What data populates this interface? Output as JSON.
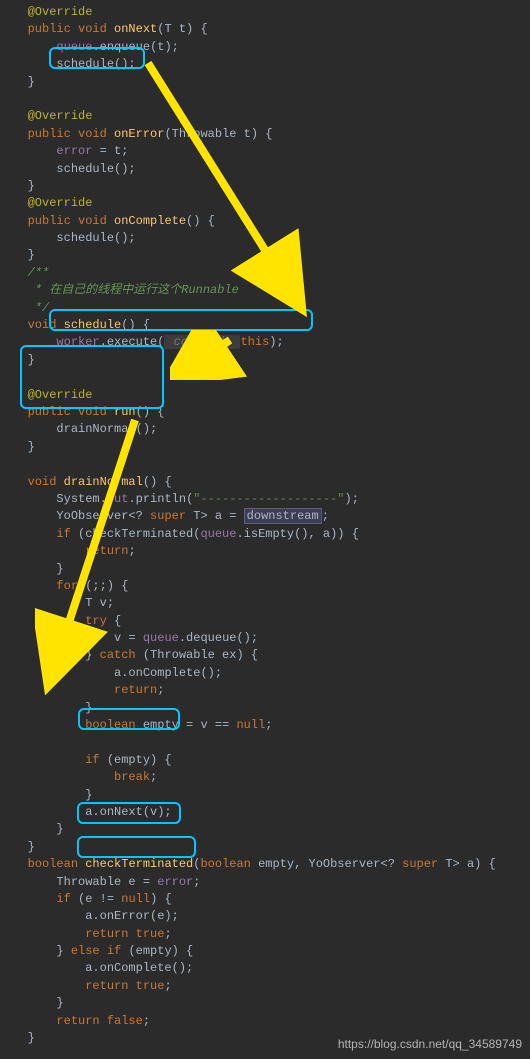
{
  "code": {
    "l01_ann": "@Override",
    "l02a": "public void",
    "l02_name": "onNext",
    "l02b": "(T t) {",
    "l03a": "queue",
    "l03b": ".",
    "l03c": "enqueue",
    "l03d": "(t);",
    "l04": "schedule();",
    "l05": "}",
    "l06_ann": "@Override",
    "l07a": "public void",
    "l07_name": "onError",
    "l07b": "(Throwable t) {",
    "l08a": "error",
    "l08b": " = t;",
    "l09": "schedule();",
    "l10": "}",
    "l11_ann": "@Override",
    "l12a": "public void",
    "l12_name": "onComplete",
    "l12b": "() {",
    "l13": "schedule();",
    "l14": "}",
    "c1": "/**",
    "c2": " * 在自己的线程中运行这个",
    "c2_tag": "Runnable",
    "c3": " */",
    "l15a": "void",
    "l15_name": "schedule",
    "l15b": "() {",
    "l16a": "worker",
    "l16b": ".execute(",
    "l16_hint": " command: ",
    "l16c": "this",
    "l16d": ");",
    "l17": "}",
    "l18_ann": "@Override",
    "l19a": "public void",
    "l19_name": "run",
    "l19b": "() {",
    "l20": "drainNormal();",
    "l21": "}",
    "dn_a": "void",
    "dn_name": "drainNormal",
    "dn_b": "() {",
    "dn1a": "System.",
    "dn1_out": "out",
    "dn1b": ".println(",
    "dn1_str": "\"-------------------\"",
    "dn1c": ");",
    "dn2a": "YoObserver<?",
    "dn2_kw": "super",
    "dn2b": " T> a = ",
    "dn2_ref": "downstream",
    "dn2c": ";",
    "dn3a": "if",
    "dn3b": " (checkTerminated(",
    "dn3_q": "queue",
    "dn3c": ".isEmpty(), a)) {",
    "dn4a": "return",
    "dn4b": ";",
    "dn5": "}",
    "dn6a": "for",
    "dn6b": " (;;) {",
    "dn7": "T v;",
    "dn8a": "try",
    "dn8b": " {",
    "dn9a": "v = ",
    "dn9_q": "queue",
    "dn9b": ".dequeue();",
    "dn10a": "} ",
    "dn10_kw": "catch",
    "dn10b": " (Throwable ex) {",
    "dn11": "a.onComplete();",
    "dn12a": "return",
    "dn12b": ";",
    "dn13": "}",
    "dn14a": "boolean",
    "dn14b": " empty = v == ",
    "dn14_kw": "null",
    "dn14c": ";",
    "dn15a": "if",
    "dn15b": " (empty) {",
    "dn16a": "break",
    "dn16b": ";",
    "dn17": "}",
    "dn18": "a.onNext(v);",
    "dn19": "}",
    "dn20": "}",
    "ct_a": "boolean",
    "ct_name": "checkTerminated",
    "ct_b": "(",
    "ct_kw1": "boolean",
    "ct_c": " empty, YoObserver<?",
    "ct_kw2": "super",
    "ct_d": " T> a) {",
    "ct1a": "Throwable e = ",
    "ct1b": "error",
    "ct1c": ";",
    "ct2a": "if",
    "ct2b": " (e != ",
    "ct2_kw": "null",
    "ct2c": ") {",
    "ct3": "a.onError(e);",
    "ct4a": "return true",
    "ct4b": ";",
    "ct5a": "} ",
    "ct5_kw": "else if",
    "ct5b": " (empty) {",
    "ct6": "a.onComplete();",
    "ct7a": "return true",
    "ct7b": ";",
    "ct8": "}",
    "ct9a": "return false",
    "ct9b": ";",
    "ct10": "}"
  },
  "watermark": "https://blog.csdn.net/qq_34589749"
}
